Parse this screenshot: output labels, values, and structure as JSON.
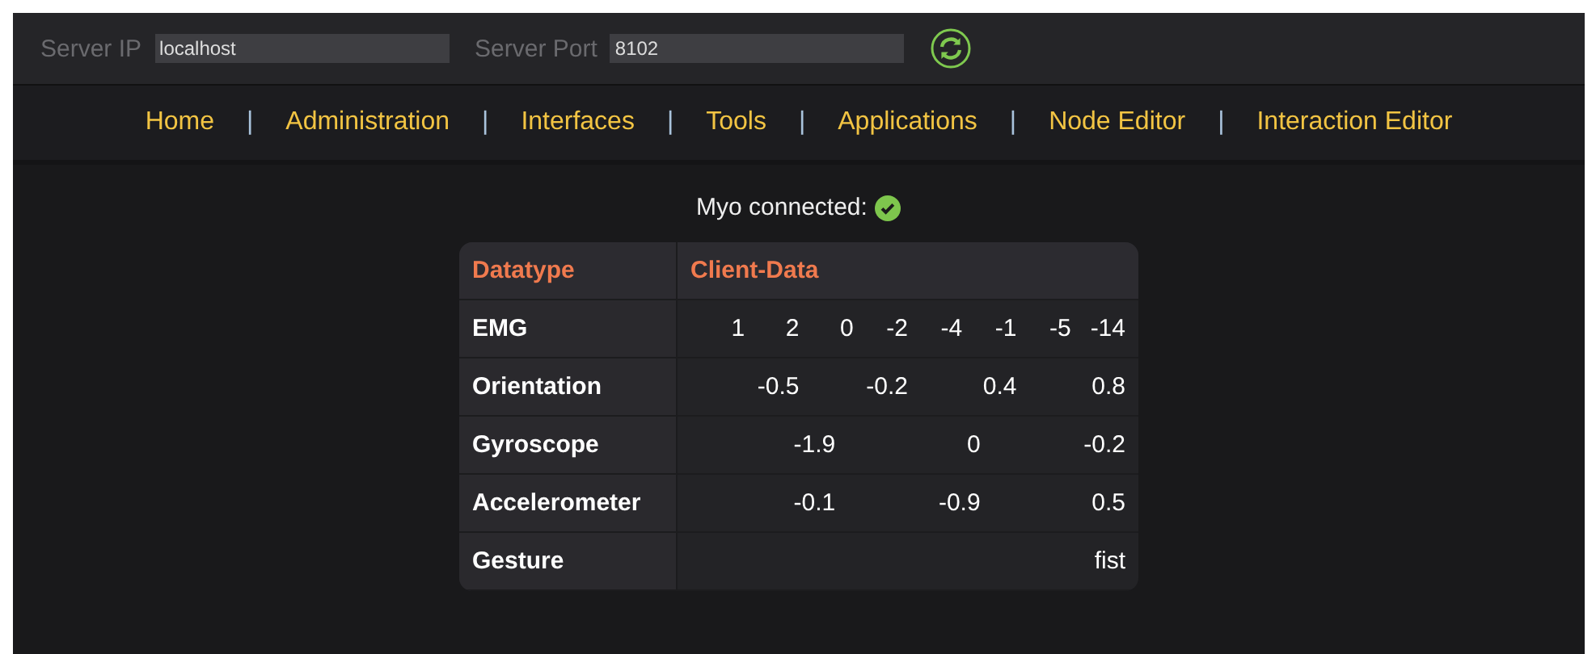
{
  "server_bar": {
    "ip_label": "Server IP",
    "ip_value": "localhost",
    "port_label": "Server Port",
    "port_value": "8102"
  },
  "nav": {
    "items": [
      {
        "kind": "link",
        "text": "Home"
      },
      {
        "kind": "separator",
        "text": "|"
      },
      {
        "kind": "link",
        "text": "Administration"
      },
      {
        "kind": "separator",
        "text": "|"
      },
      {
        "kind": "link",
        "text": "Interfaces"
      },
      {
        "kind": "separator",
        "text": "|"
      },
      {
        "kind": "link",
        "text": "Tools"
      },
      {
        "kind": "separator",
        "text": "|"
      },
      {
        "kind": "link",
        "text": "Applications"
      },
      {
        "kind": "separator",
        "text": "|"
      },
      {
        "kind": "link",
        "text": "Node Editor"
      },
      {
        "kind": "separator",
        "text": "|"
      },
      {
        "kind": "link",
        "text": "Interaction Editor"
      }
    ]
  },
  "status": {
    "text": "Myo connected:",
    "connected": true
  },
  "table": {
    "columns": [
      "Datatype",
      "Client-Data"
    ],
    "rows": [
      {
        "label": "EMG",
        "values": [
          "1",
          "2",
          "0",
          "-2",
          "-4",
          "-1",
          "-5",
          "-14"
        ]
      },
      {
        "label": "Orientation",
        "values": [
          "-0.5",
          "-0.2",
          "0.4",
          "0.8"
        ]
      },
      {
        "label": "Gyroscope",
        "values": [
          "-1.9",
          "0",
          "-0.2"
        ]
      },
      {
        "label": "Accelerometer",
        "values": [
          "-0.1",
          "-0.9",
          "0.5"
        ]
      },
      {
        "label": "Gesture",
        "values": [
          "fist"
        ]
      }
    ]
  }
}
